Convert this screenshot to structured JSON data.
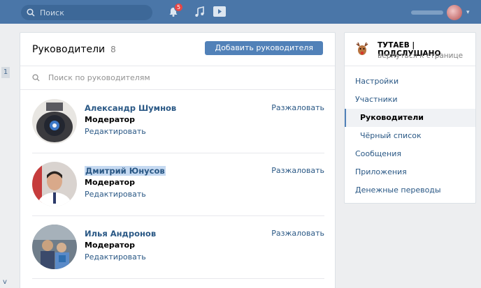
{
  "topbar": {
    "search_placeholder": "Поиск",
    "notifications_count": "5",
    "user_avatar_colors": [
      "#f2c6c6",
      "#b65050"
    ]
  },
  "left": {
    "page_number": "1",
    "bottom_char": "v"
  },
  "main": {
    "title": "Руководители",
    "count": "8",
    "add_button": "Добавить руководителя",
    "search_placeholder": "Поиск по руководителям",
    "members": [
      {
        "name": "Александр Шумнов",
        "role": "Модератор",
        "edit": "Редактировать",
        "demote": "Разжаловать",
        "highlighted": false
      },
      {
        "name": "Дмитрий Юнусов",
        "role": "Модератор",
        "edit": "Редактировать",
        "demote": "Разжаловать",
        "highlighted": true
      },
      {
        "name": "Илья Андронов",
        "role": "Модератор",
        "edit": "Редактировать",
        "demote": "Разжаловать",
        "highlighted": false
      }
    ]
  },
  "side": {
    "group_name": "ТУТАЕВ | ПОДСЛУШАНО",
    "back_link": "вернуться к странице",
    "menu": [
      {
        "label": "Настройки",
        "active": false,
        "sub": false
      },
      {
        "label": "Участники",
        "active": false,
        "sub": false
      },
      {
        "label": "Руководители",
        "active": true,
        "sub": true
      },
      {
        "label": "Чёрный список",
        "active": false,
        "sub": true
      },
      {
        "label": "Сообщения",
        "active": false,
        "sub": false
      },
      {
        "label": "Приложения",
        "active": false,
        "sub": false
      },
      {
        "label": "Денежные переводы",
        "active": false,
        "sub": false
      }
    ]
  },
  "colors": {
    "header_bg": "#4a76a8",
    "button_bg": "#5181b8",
    "link": "#2a5885",
    "page_bg": "#edeef0"
  }
}
